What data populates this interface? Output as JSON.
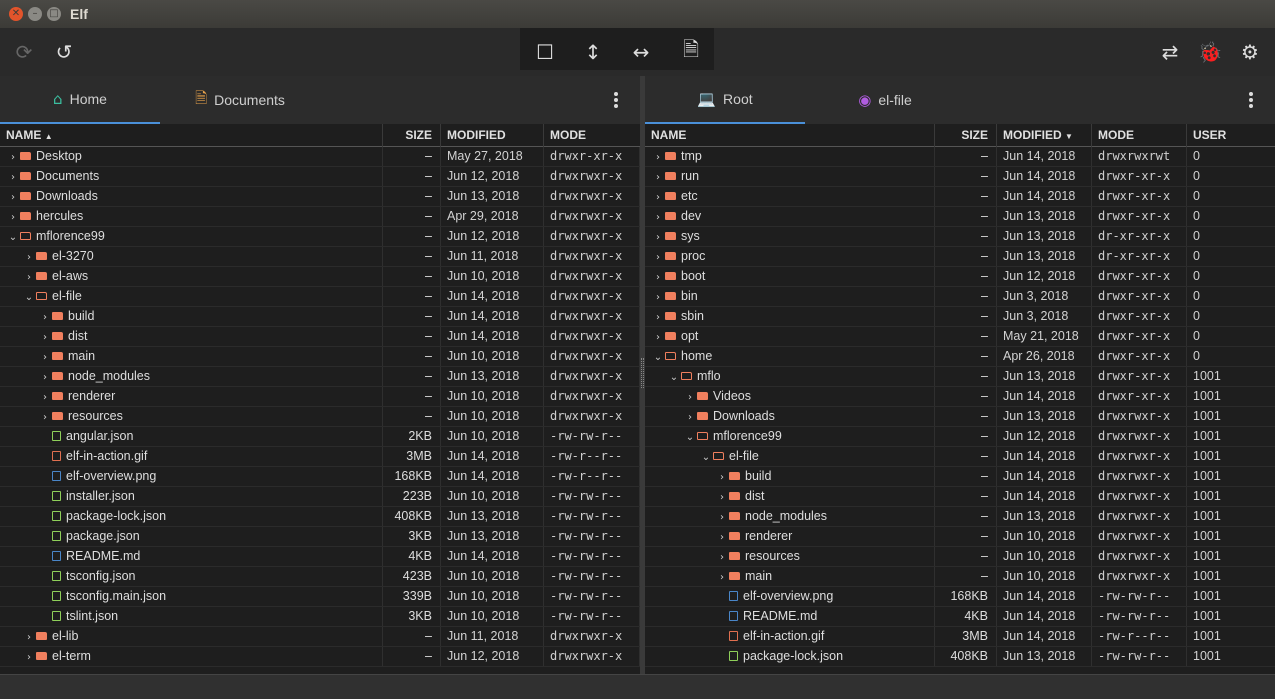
{
  "window": {
    "title": "Elf"
  },
  "toolbar": {
    "left": [
      {
        "name": "redo-icon",
        "glyph": "⟳"
      },
      {
        "name": "undo-icon",
        "glyph": "↺"
      }
    ],
    "center": [
      {
        "name": "square-layout-icon",
        "glyph": "☐"
      },
      {
        "name": "vertical-split-icon",
        "glyph": "↕"
      },
      {
        "name": "horizontal-split-icon",
        "glyph": "↔"
      },
      {
        "name": "document-icon",
        "glyph": "🗎"
      }
    ],
    "right": [
      {
        "name": "sync-icon",
        "glyph": "⇄"
      },
      {
        "name": "bug-icon",
        "glyph": "🐞"
      },
      {
        "name": "settings-icon",
        "glyph": "⚙"
      }
    ]
  },
  "left": {
    "tabs": [
      {
        "label": "Home",
        "icon": "home-icon",
        "glyph": "⌂",
        "color": "#3bbfa0",
        "active": true
      },
      {
        "label": "Documents",
        "icon": "document-icon",
        "glyph": "🗎",
        "color": "#e8a24a",
        "active": false
      }
    ],
    "columns": {
      "name": "NAME",
      "size": "SIZE",
      "modified": "MODIFIED",
      "mode": "MODE",
      "sort": "▲"
    },
    "rows": [
      {
        "d": 1,
        "t": "folder",
        "ch": "›",
        "name": "Desktop",
        "size": "–",
        "mod": "May 27, 2018",
        "mode": "drwxr-xr-x"
      },
      {
        "d": 1,
        "t": "folder",
        "ch": "›",
        "name": "Documents",
        "size": "–",
        "mod": "Jun 12, 2018",
        "mode": "drwxrwxr-x"
      },
      {
        "d": 1,
        "t": "folder",
        "ch": "›",
        "name": "Downloads",
        "size": "–",
        "mod": "Jun 13, 2018",
        "mode": "drwxrwxr-x"
      },
      {
        "d": 1,
        "t": "folder",
        "ch": "›",
        "name": "hercules",
        "size": "–",
        "mod": "Apr 29, 2018",
        "mode": "drwxrwxr-x"
      },
      {
        "d": 1,
        "t": "open",
        "ch": "⌄",
        "name": "mflorence99",
        "size": "–",
        "mod": "Jun 12, 2018",
        "mode": "drwxrwxr-x"
      },
      {
        "d": 2,
        "t": "folder",
        "ch": "›",
        "name": "el-3270",
        "size": "–",
        "mod": "Jun 11, 2018",
        "mode": "drwxrwxr-x"
      },
      {
        "d": 2,
        "t": "folder",
        "ch": "›",
        "name": "el-aws",
        "size": "–",
        "mod": "Jun 10, 2018",
        "mode": "drwxrwxr-x"
      },
      {
        "d": 2,
        "t": "open",
        "ch": "⌄",
        "name": "el-file",
        "size": "–",
        "mod": "Jun 14, 2018",
        "mode": "drwxrwxr-x"
      },
      {
        "d": 3,
        "t": "folder",
        "ch": "›",
        "name": "build",
        "size": "–",
        "mod": "Jun 14, 2018",
        "mode": "drwxrwxr-x"
      },
      {
        "d": 3,
        "t": "folder",
        "ch": "›",
        "name": "dist",
        "size": "–",
        "mod": "Jun 14, 2018",
        "mode": "drwxrwxr-x"
      },
      {
        "d": 3,
        "t": "folder",
        "ch": "›",
        "name": "main",
        "size": "–",
        "mod": "Jun 10, 2018",
        "mode": "drwxrwxr-x"
      },
      {
        "d": 3,
        "t": "folder",
        "ch": "›",
        "name": "node_modules",
        "size": "–",
        "mod": "Jun 13, 2018",
        "mode": "drwxrwxr-x"
      },
      {
        "d": 3,
        "t": "folder",
        "ch": "›",
        "name": "renderer",
        "size": "–",
        "mod": "Jun 10, 2018",
        "mode": "drwxrwxr-x"
      },
      {
        "d": 3,
        "t": "folder",
        "ch": "›",
        "name": "resources",
        "size": "–",
        "mod": "Jun 10, 2018",
        "mode": "drwxrwxr-x"
      },
      {
        "d": 3,
        "t": "file",
        "ch": "",
        "name": "angular.json",
        "size": "2KB",
        "mod": "Jun 10, 2018",
        "mode": "-rw-rw-r--"
      },
      {
        "d": 3,
        "t": "gif",
        "ch": "",
        "name": "elf-in-action.gif",
        "size": "3MB",
        "mod": "Jun 14, 2018",
        "mode": "-rw-r--r--"
      },
      {
        "d": 3,
        "t": "png",
        "ch": "",
        "name": "elf-overview.png",
        "size": "168KB",
        "mod": "Jun 14, 2018",
        "mode": "-rw-r--r--"
      },
      {
        "d": 3,
        "t": "file",
        "ch": "",
        "name": "installer.json",
        "size": "223B",
        "mod": "Jun 10, 2018",
        "mode": "-rw-rw-r--"
      },
      {
        "d": 3,
        "t": "file",
        "ch": "",
        "name": "package-lock.json",
        "size": "408KB",
        "mod": "Jun 13, 2018",
        "mode": "-rw-rw-r--"
      },
      {
        "d": 3,
        "t": "file",
        "ch": "",
        "name": "package.json",
        "size": "3KB",
        "mod": "Jun 13, 2018",
        "mode": "-rw-rw-r--"
      },
      {
        "d": 3,
        "t": "md",
        "ch": "",
        "name": "README.md",
        "size": "4KB",
        "mod": "Jun 14, 2018",
        "mode": "-rw-rw-r--"
      },
      {
        "d": 3,
        "t": "file",
        "ch": "",
        "name": "tsconfig.json",
        "size": "423B",
        "mod": "Jun 10, 2018",
        "mode": "-rw-rw-r--"
      },
      {
        "d": 3,
        "t": "file",
        "ch": "",
        "name": "tsconfig.main.json",
        "size": "339B",
        "mod": "Jun 10, 2018",
        "mode": "-rw-rw-r--"
      },
      {
        "d": 3,
        "t": "file",
        "ch": "",
        "name": "tslint.json",
        "size": "3KB",
        "mod": "Jun 10, 2018",
        "mode": "-rw-rw-r--"
      },
      {
        "d": 2,
        "t": "folder",
        "ch": "›",
        "name": "el-lib",
        "size": "–",
        "mod": "Jun 11, 2018",
        "mode": "drwxrwxr-x"
      },
      {
        "d": 2,
        "t": "folder",
        "ch": "›",
        "name": "el-term",
        "size": "–",
        "mod": "Jun 12, 2018",
        "mode": "drwxrwxr-x"
      }
    ]
  },
  "right": {
    "tabs": [
      {
        "label": "Root",
        "icon": "laptop-icon",
        "glyph": "💻",
        "color": "#3bbf6a",
        "active": true
      },
      {
        "label": "el-file",
        "icon": "github-icon",
        "glyph": "◉",
        "color": "#b05ce0",
        "active": false
      }
    ],
    "columns": {
      "name": "NAME",
      "size": "SIZE",
      "modified": "MODIFIED",
      "mode": "MODE",
      "user": "USER",
      "sort": "▼"
    },
    "rows": [
      {
        "d": 1,
        "t": "folder",
        "ch": "›",
        "name": "tmp",
        "size": "–",
        "mod": "Jun 14, 2018",
        "mode": "drwxrwxrwt",
        "user": "0"
      },
      {
        "d": 1,
        "t": "folder",
        "ch": "›",
        "name": "run",
        "size": "–",
        "mod": "Jun 14, 2018",
        "mode": "drwxr-xr-x",
        "user": "0"
      },
      {
        "d": 1,
        "t": "folder",
        "ch": "›",
        "name": "etc",
        "size": "–",
        "mod": "Jun 14, 2018",
        "mode": "drwxr-xr-x",
        "user": "0"
      },
      {
        "d": 1,
        "t": "folder",
        "ch": "›",
        "name": "dev",
        "size": "–",
        "mod": "Jun 13, 2018",
        "mode": "drwxr-xr-x",
        "user": "0"
      },
      {
        "d": 1,
        "t": "folder",
        "ch": "›",
        "name": "sys",
        "size": "–",
        "mod": "Jun 13, 2018",
        "mode": "dr-xr-xr-x",
        "user": "0"
      },
      {
        "d": 1,
        "t": "folder",
        "ch": "›",
        "name": "proc",
        "size": "–",
        "mod": "Jun 13, 2018",
        "mode": "dr-xr-xr-x",
        "user": "0"
      },
      {
        "d": 1,
        "t": "folder",
        "ch": "›",
        "name": "boot",
        "size": "–",
        "mod": "Jun 12, 2018",
        "mode": "drwxr-xr-x",
        "user": "0"
      },
      {
        "d": 1,
        "t": "folder",
        "ch": "›",
        "name": "bin",
        "size": "–",
        "mod": "Jun 3, 2018",
        "mode": "drwxr-xr-x",
        "user": "0"
      },
      {
        "d": 1,
        "t": "folder",
        "ch": "›",
        "name": "sbin",
        "size": "–",
        "mod": "Jun 3, 2018",
        "mode": "drwxr-xr-x",
        "user": "0"
      },
      {
        "d": 1,
        "t": "folder",
        "ch": "›",
        "name": "opt",
        "size": "–",
        "mod": "May 21, 2018",
        "mode": "drwxr-xr-x",
        "user": "0"
      },
      {
        "d": 1,
        "t": "open",
        "ch": "⌄",
        "name": "home",
        "size": "–",
        "mod": "Apr 26, 2018",
        "mode": "drwxr-xr-x",
        "user": "0"
      },
      {
        "d": 2,
        "t": "open",
        "ch": "⌄",
        "name": "mflo",
        "size": "–",
        "mod": "Jun 13, 2018",
        "mode": "drwxr-xr-x",
        "user": "1001"
      },
      {
        "d": 3,
        "t": "folder",
        "ch": "›",
        "name": "Videos",
        "size": "–",
        "mod": "Jun 14, 2018",
        "mode": "drwxr-xr-x",
        "user": "1001"
      },
      {
        "d": 3,
        "t": "folder",
        "ch": "›",
        "name": "Downloads",
        "size": "–",
        "mod": "Jun 13, 2018",
        "mode": "drwxrwxr-x",
        "user": "1001"
      },
      {
        "d": 3,
        "t": "open",
        "ch": "⌄",
        "name": "mflorence99",
        "size": "–",
        "mod": "Jun 12, 2018",
        "mode": "drwxrwxr-x",
        "user": "1001"
      },
      {
        "d": 4,
        "t": "open",
        "ch": "⌄",
        "name": "el-file",
        "size": "–",
        "mod": "Jun 14, 2018",
        "mode": "drwxrwxr-x",
        "user": "1001"
      },
      {
        "d": 5,
        "t": "folder",
        "ch": "›",
        "name": "build",
        "size": "–",
        "mod": "Jun 14, 2018",
        "mode": "drwxrwxr-x",
        "user": "1001"
      },
      {
        "d": 5,
        "t": "folder",
        "ch": "›",
        "name": "dist",
        "size": "–",
        "mod": "Jun 14, 2018",
        "mode": "drwxrwxr-x",
        "user": "1001"
      },
      {
        "d": 5,
        "t": "folder",
        "ch": "›",
        "name": "node_modules",
        "size": "–",
        "mod": "Jun 13, 2018",
        "mode": "drwxrwxr-x",
        "user": "1001"
      },
      {
        "d": 5,
        "t": "folder",
        "ch": "›",
        "name": "renderer",
        "size": "–",
        "mod": "Jun 10, 2018",
        "mode": "drwxrwxr-x",
        "user": "1001"
      },
      {
        "d": 5,
        "t": "folder",
        "ch": "›",
        "name": "resources",
        "size": "–",
        "mod": "Jun 10, 2018",
        "mode": "drwxrwxr-x",
        "user": "1001"
      },
      {
        "d": 5,
        "t": "folder",
        "ch": "›",
        "name": "main",
        "size": "–",
        "mod": "Jun 10, 2018",
        "mode": "drwxrwxr-x",
        "user": "1001"
      },
      {
        "d": 5,
        "t": "png",
        "ch": "",
        "name": "elf-overview.png",
        "size": "168KB",
        "mod": "Jun 14, 2018",
        "mode": "-rw-rw-r--",
        "user": "1001"
      },
      {
        "d": 5,
        "t": "md",
        "ch": "",
        "name": "README.md",
        "size": "4KB",
        "mod": "Jun 14, 2018",
        "mode": "-rw-rw-r--",
        "user": "1001"
      },
      {
        "d": 5,
        "t": "gif",
        "ch": "",
        "name": "elf-in-action.gif",
        "size": "3MB",
        "mod": "Jun 14, 2018",
        "mode": "-rw-r--r--",
        "user": "1001"
      },
      {
        "d": 5,
        "t": "file",
        "ch": "",
        "name": "package-lock.json",
        "size": "408KB",
        "mod": "Jun 13, 2018",
        "mode": "-rw-rw-r--",
        "user": "1001"
      }
    ]
  }
}
